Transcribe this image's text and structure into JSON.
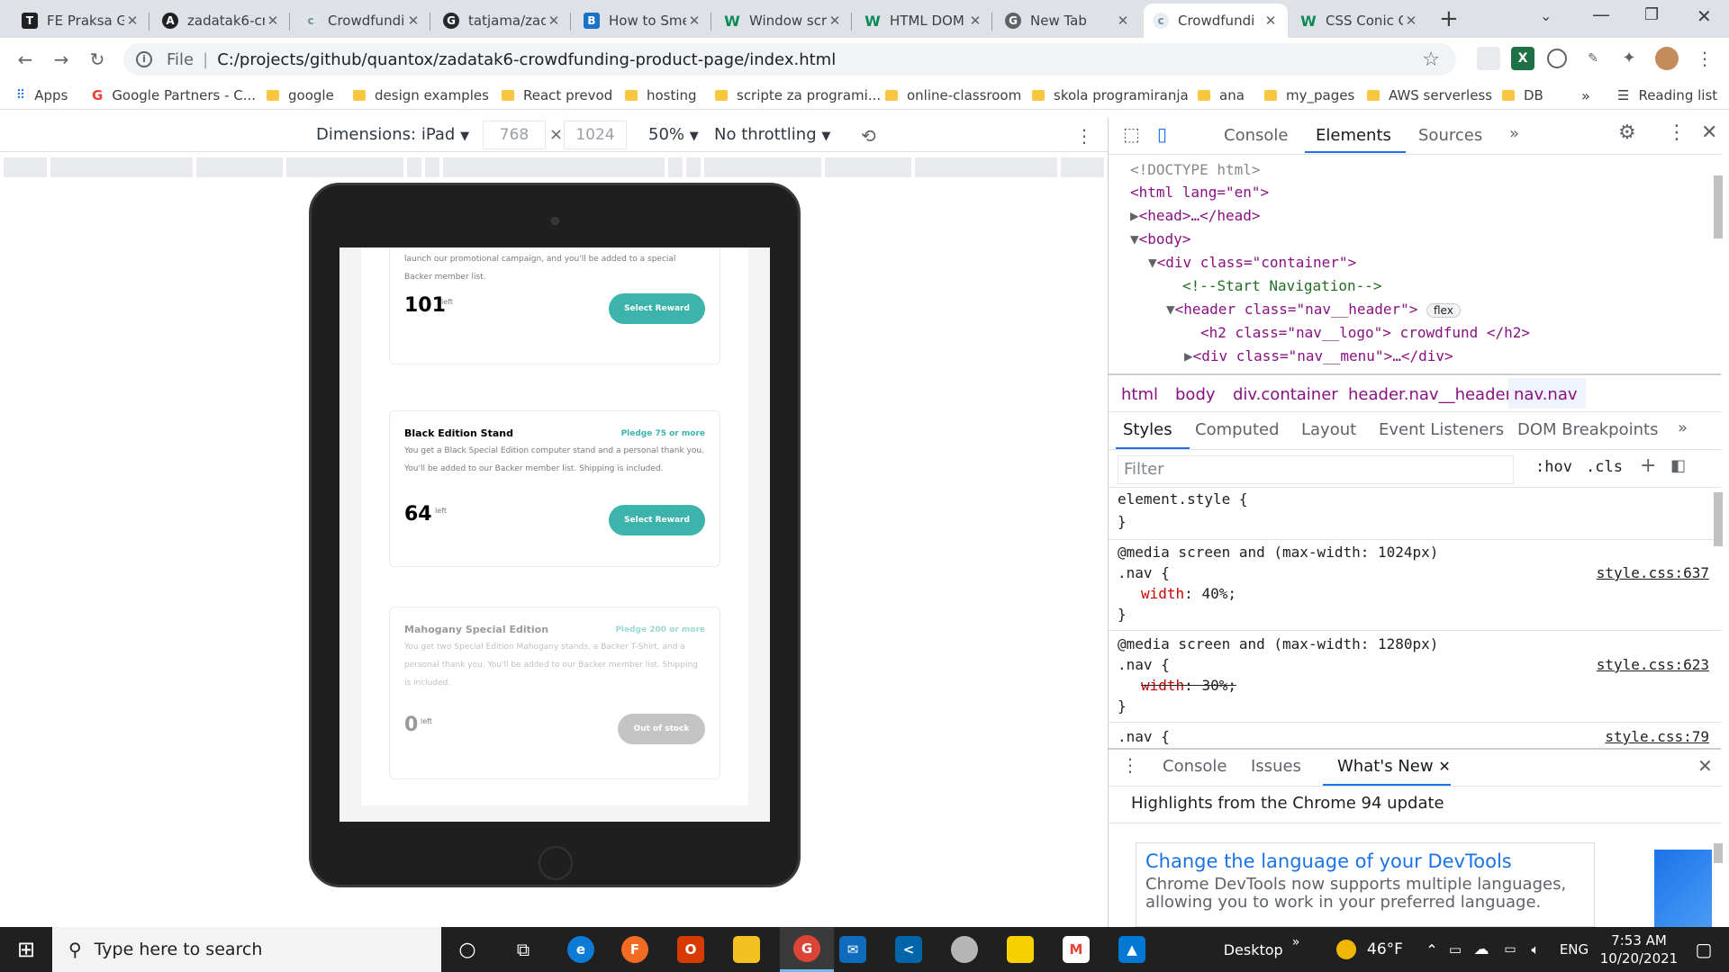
{
  "tabs": [
    {
      "title": "FE Praksa G",
      "fav": "T",
      "color": "#202124"
    },
    {
      "title": "zadatak6-cr",
      "fav": "A",
      "color": "#202124"
    },
    {
      "title": "Crowdfundi",
      "fav": "C",
      "color": "#9fb4c2"
    },
    {
      "title": "tatjama/zad",
      "fav": "G",
      "color": "#24292e"
    },
    {
      "title": "How to Sme",
      "fav": "B",
      "color": "#1a73c7"
    },
    {
      "title": "Window scr",
      "fav": "W",
      "color": "#0a8a57"
    },
    {
      "title": "HTML DOM",
      "fav": "W",
      "color": "#0a8a57"
    },
    {
      "title": "New Tab",
      "fav": "G",
      "color": "#5f6368"
    },
    {
      "title": "Crowdfundi",
      "fav": "C",
      "color": "#9fb4c2"
    },
    {
      "title": "CSS Conic G",
      "fav": "W",
      "color": "#0a8a57"
    }
  ],
  "omnibox": {
    "file_label": "File",
    "url": "C:/projects/github/quantox/zadatak6-crowdfunding-product-page/index.html"
  },
  "bookmarks": [
    "Apps",
    "Google Partners - C...",
    "google",
    "design examples",
    "React prevod",
    "hosting",
    "scripte za programi...",
    "online-classroom",
    "skola programiranja",
    "ana",
    "my_pages",
    "AWS serverless",
    "DB"
  ],
  "reading_list": "Reading list",
  "device_toolbar": {
    "dimensions": "Dimensions: iPad",
    "width": "768",
    "height": "1024",
    "times": "×",
    "zoom": "50%",
    "throttling": "No throttling"
  },
  "rewards": [
    {
      "name": "",
      "pledge": "",
      "desc": "launch our promotional campaign, and you'll be added to a special Backer member list.",
      "count": "101",
      "left": "left",
      "button": "Select Reward",
      "out": false
    },
    {
      "name": "Black Edition Stand",
      "pledge": "Pledge 75 or more",
      "desc": "You get a Black Special Edition computer stand and a personal thank you. You'll be added to our Backer member list. Shipping is included.",
      "count": "64",
      "left": "left",
      "button": "Select Reward",
      "out": false
    },
    {
      "name": "Mahogany Special Edition",
      "pledge": "Pledge 200 or more",
      "desc": "You get two Special Edition Mahogany stands, a Backer T-Shirt, and a personal thank you. You'll be added to our Backer member list. Shipping is included.",
      "count": "0",
      "left": "left",
      "button": "Out of stock",
      "out": true
    }
  ],
  "devtools": {
    "tabs": [
      "Console",
      "Elements",
      "Sources"
    ],
    "elements": [
      "<!DOCTYPE html>",
      "<html lang=\"en\">",
      "<head>…</head>",
      "<body>",
      "<div class=\"container\">",
      "<!--Start Navigation-->",
      "<header class=\"nav__header\">",
      "<h2 class=\"nav__logo\"> crowdfund </h2>",
      "<div class=\"nav__menu\">…</div>"
    ],
    "flex_badge": "flex",
    "breadcrumbs": [
      "html",
      "body",
      "div.container",
      "header.nav__header",
      "nav.nav"
    ],
    "style_tabs": [
      "Styles",
      "Computed",
      "Layout",
      "Event Listeners",
      "DOM Breakpoints"
    ],
    "filter_placeholder": "Filter",
    "hov": ":hov",
    "cls": ".cls",
    "rules": [
      {
        "line1": "element.style {",
        "line2": "}"
      },
      {
        "media": "@media screen and (max-width: 1024px)",
        "selector": ".nav {",
        "prop": "width",
        "value": "40%;",
        "close": "}",
        "source": "style.css:637",
        "struck": false
      },
      {
        "media": "@media screen and (max-width: 1280px)",
        "selector": ".nav {",
        "prop": "width",
        "value": "30%;",
        "close": "}",
        "source": "style.css:623",
        "struck": true
      },
      {
        "selector": ".nav {",
        "source": "style.css:79"
      }
    ],
    "drawer_tabs": [
      "Console",
      "Issues",
      "What's New"
    ],
    "highlights": "Highlights from the Chrome 94 update",
    "card_title": "Change the language of your DevTools",
    "card_text": "Chrome DevTools now supports multiple languages, allowing you to work in your preferred language."
  },
  "taskbar": {
    "search": "Type here to search",
    "desktop": "Desktop",
    "temp": "46°F",
    "lang": "ENG",
    "time": "7:53 AM",
    "date": "10/20/2021"
  }
}
